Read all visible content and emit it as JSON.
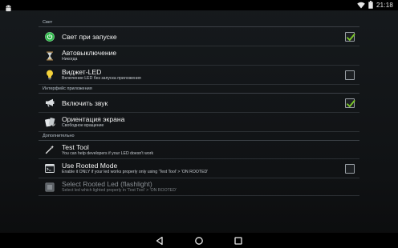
{
  "status_bar": {
    "time": "21:18",
    "icons": [
      "android-icon",
      "wifi-icon",
      "battery-icon"
    ]
  },
  "sections": [
    {
      "header": "Свет",
      "items": [
        {
          "title": "Свет при запуске",
          "summary": "",
          "icon": "power-icon",
          "checkbox": true,
          "checked": true,
          "enabled": true
        },
        {
          "title": "Автовыключение",
          "summary": "Никогда",
          "icon": "hourglass-icon",
          "checkbox": false,
          "enabled": true
        },
        {
          "title": "Виджет-LED",
          "summary": "Включение LED без запуска приложения",
          "icon": "lightbulb-icon",
          "checkbox": true,
          "checked": false,
          "enabled": true
        }
      ]
    },
    {
      "header": "Интерфейс приложения",
      "items": [
        {
          "title": "Включить звук",
          "summary": "",
          "icon": "megaphone-icon",
          "checkbox": true,
          "checked": true,
          "enabled": true
        },
        {
          "title": "Ориентация экрана",
          "summary": "Свободное вращение",
          "icon": "screen-rotation-icon",
          "checkbox": false,
          "enabled": true
        }
      ]
    },
    {
      "header": "Дополнительно",
      "items": [
        {
          "title": "Test Tool",
          "summary": "You can help developers if your LED doesn't work",
          "icon": "magic-wand-icon",
          "checkbox": false,
          "enabled": true
        },
        {
          "title": "Use Rooted Mode",
          "summary": "Enable it ONLY if your led works properly only using 'Test Tool' > 'ON ROOTED'",
          "icon": "terminal-icon",
          "checkbox": true,
          "checked": false,
          "enabled": true
        },
        {
          "title": "Select Rooted Led (flashlight)",
          "summary": "Select led which lighted properly in 'Test Tool' > 'ON ROOTED'",
          "icon": "list-icon",
          "checkbox": false,
          "enabled": false
        }
      ]
    }
  ],
  "nav_bar": {
    "buttons": [
      "back-icon",
      "home-icon",
      "recents-icon"
    ]
  },
  "colors": {
    "check_green": "#7ecb2a",
    "power_green": "#2fb84a",
    "bulb_yellow": "#f5d23a"
  }
}
